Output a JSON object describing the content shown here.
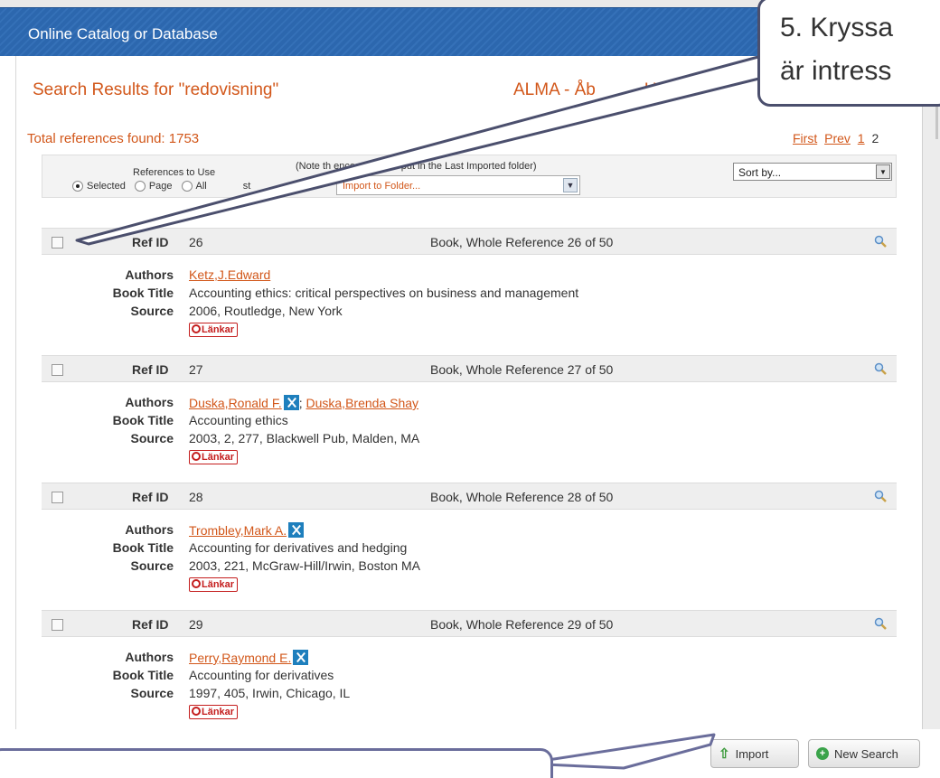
{
  "window": {
    "title": "Online Catalog or Database"
  },
  "search": {
    "heading": "Search Results for \"redovisning\"",
    "database": "ALMA - Åb",
    "database_tail": "Uni",
    "total": "Total references found: 1753"
  },
  "pager": {
    "first": "First",
    "prev": "Prev",
    "page1": "1",
    "page2": "2"
  },
  "toolbar": {
    "refs_label": "References to Use",
    "note": "(Note th         ences are also put in the Last Imported folder)",
    "radio_selected": "Selected",
    "radio_page": "Page",
    "radio_all": "All",
    "radio_all_tail": "st",
    "folder_placeholder": "Import to Folder...",
    "sort_label": "Sort by..."
  },
  "labels": {
    "refid": "Ref ID",
    "authors": "Authors",
    "book_title": "Book Title",
    "source": "Source",
    "links": "Länkar"
  },
  "references": [
    {
      "id": "26",
      "desc": "Book, Whole Reference 26 of 50",
      "authors": [
        "Ketz,J.Edward"
      ],
      "author_icons": [
        false
      ],
      "title": "Accounting ethics: critical perspectives on business and management",
      "source": "2006, Routledge, New York"
    },
    {
      "id": "27",
      "desc": "Book, Whole Reference 27 of 50",
      "authors": [
        "Duska,Ronald F.",
        "Duska,Brenda Shay"
      ],
      "author_icons": [
        true,
        false
      ],
      "title": "Accounting ethics",
      "source": "2003, 2, 277, Blackwell Pub, Malden, MA"
    },
    {
      "id": "28",
      "desc": "Book, Whole Reference 28 of 50",
      "authors": [
        "Trombley,Mark A."
      ],
      "author_icons": [
        true
      ],
      "title": "Accounting for derivatives and hedging",
      "source": "2003, 221, McGraw-Hill/Irwin, Boston MA"
    },
    {
      "id": "29",
      "desc": "Book, Whole Reference 29 of 50",
      "authors": [
        "Perry,Raymond E."
      ],
      "author_icons": [
        true
      ],
      "title": "Accounting for derivatives",
      "source": "1997, 405, Irwin, Chicago, IL"
    }
  ],
  "buttons": {
    "import": "Import",
    "new_search": "New Search"
  },
  "callout": {
    "line1": "5. Kryssa",
    "line2": "är intress"
  },
  "colors": {
    "accent": "#d2571a",
    "titlebar": "#2c67ae",
    "callout_border": "#4b4f6d"
  }
}
